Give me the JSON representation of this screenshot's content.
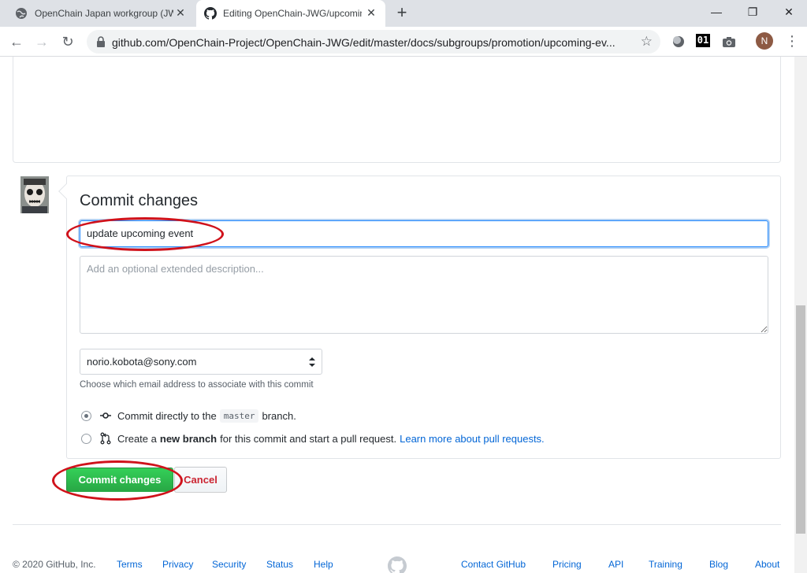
{
  "browser": {
    "tabs": [
      {
        "title": "OpenChain Japan workgroup (JWG",
        "active": false
      },
      {
        "title": "Editing OpenChain-JWG/upcoming",
        "active": true
      }
    ],
    "url": "github.com/OpenChain-Project/OpenChain-JWG/edit/master/docs/subgroups/promotion/upcoming-ev...",
    "profile_initial": "N",
    "extension_label": "01",
    "window_controls": [
      "minimize",
      "maximize",
      "close"
    ]
  },
  "commit": {
    "title": "Commit changes",
    "summary_value": "update upcoming event",
    "description_placeholder": "Add an optional extended description...",
    "email_selected": "norio.kobota@sony.com",
    "email_hint": "Choose which email address to associate with this commit",
    "option_direct": {
      "pre": "Commit directly to the",
      "branch": "master",
      "post": "branch.",
      "selected": true
    },
    "option_new_branch": {
      "pre": "Create a",
      "bold": "new branch",
      "post": "for this commit and start a pull request.",
      "link": "Learn more about pull requests.",
      "selected": false
    },
    "commit_button": "Commit changes",
    "cancel_button": "Cancel"
  },
  "footer": {
    "copyright": "© 2020 GitHub, Inc.",
    "links": [
      "Terms",
      "Privacy",
      "Security",
      "Status",
      "Help",
      "Contact GitHub",
      "Pricing",
      "API",
      "Training",
      "Blog",
      "About"
    ]
  },
  "colors": {
    "accent_blue": "#0366d6",
    "commit_green": "#28a745",
    "cancel_red": "#cb2431",
    "annotation_red": "#d0121b"
  }
}
